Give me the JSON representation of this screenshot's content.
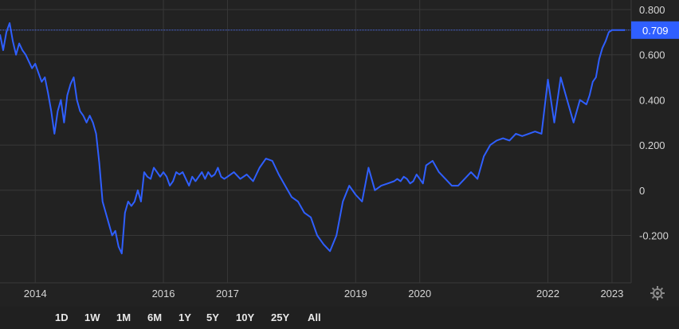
{
  "chart_data": {
    "type": "line",
    "ylim": [
      -0.3,
      0.8
    ],
    "y_ticks": [
      "0.800",
      "0.600",
      "0.400",
      "0.200",
      "0",
      "-0.200"
    ],
    "y_tick_values": [
      0.8,
      0.6,
      0.4,
      0.2,
      0,
      -0.2
    ],
    "x_ticks": [
      "2014",
      "2016",
      "2017",
      "2019",
      "2020",
      "2022",
      "2023"
    ],
    "x_tick_values": [
      2014.0,
      2016.0,
      2017.0,
      2019.0,
      2020.0,
      2022.0,
      2023.0
    ],
    "xlim": [
      2013.45,
      2023.2
    ],
    "grid": true,
    "last_value_label": "0.709",
    "last_value": 0.709,
    "line_color": "#2f5fff",
    "series": [
      {
        "x": [
          2013.45,
          2013.5,
          2013.55,
          2013.6,
          2013.65,
          2013.7,
          2013.75,
          2013.8,
          2013.85,
          2013.9,
          2013.95,
          2014.0,
          2014.05,
          2014.1,
          2014.15,
          2014.2,
          2014.25,
          2014.3,
          2014.35,
          2014.4,
          2014.45,
          2014.5,
          2014.55,
          2014.6,
          2014.65,
          2014.7,
          2014.75,
          2014.8,
          2014.85,
          2014.9,
          2014.95,
          2015.0,
          2015.05,
          2015.1,
          2015.15,
          2015.2,
          2015.25,
          2015.3,
          2015.35,
          2015.4,
          2015.45,
          2015.5,
          2015.55,
          2015.6,
          2015.65,
          2015.7,
          2015.75,
          2015.8,
          2015.85,
          2015.9,
          2015.95,
          2016.0,
          2016.05,
          2016.1,
          2016.15,
          2016.2,
          2016.25,
          2016.3,
          2016.35,
          2016.4,
          2016.45,
          2016.5,
          2016.55,
          2016.6,
          2016.65,
          2016.7,
          2016.75,
          2016.8,
          2016.85,
          2016.9,
          2016.95,
          2017.0,
          2017.1,
          2017.2,
          2017.3,
          2017.4,
          2017.5,
          2017.6,
          2017.7,
          2017.8,
          2017.9,
          2018.0,
          2018.1,
          2018.2,
          2018.3,
          2018.4,
          2018.5,
          2018.6,
          2018.7,
          2018.8,
          2018.9,
          2019.0,
          2019.1,
          2019.2,
          2019.3,
          2019.4,
          2019.5,
          2019.6,
          2019.65,
          2019.7,
          2019.75,
          2019.8,
          2019.85,
          2019.9,
          2019.95,
          2020.0,
          2020.05,
          2020.1,
          2020.2,
          2020.3,
          2020.4,
          2020.5,
          2020.6,
          2020.7,
          2020.8,
          2020.9,
          2021.0,
          2021.1,
          2021.2,
          2021.3,
          2021.4,
          2021.5,
          2021.6,
          2021.7,
          2021.8,
          2021.9,
          2022.0,
          2022.1,
          2022.2,
          2022.3,
          2022.4,
          2022.5,
          2022.6,
          2022.65,
          2022.7,
          2022.75,
          2022.8,
          2022.85,
          2022.9,
          2022.95,
          2023.0,
          2023.05,
          2023.1,
          2023.15,
          2023.2
        ],
        "y": [
          0.69,
          0.62,
          0.7,
          0.74,
          0.66,
          0.6,
          0.65,
          0.62,
          0.6,
          0.57,
          0.54,
          0.56,
          0.52,
          0.48,
          0.5,
          0.43,
          0.35,
          0.25,
          0.35,
          0.4,
          0.3,
          0.42,
          0.47,
          0.5,
          0.4,
          0.35,
          0.33,
          0.3,
          0.33,
          0.3,
          0.25,
          0.12,
          -0.05,
          -0.1,
          -0.15,
          -0.2,
          -0.18,
          -0.25,
          -0.28,
          -0.1,
          -0.05,
          -0.07,
          -0.05,
          0.0,
          -0.05,
          0.08,
          0.06,
          0.05,
          0.1,
          0.08,
          0.06,
          0.08,
          0.06,
          0.02,
          0.04,
          0.08,
          0.07,
          0.08,
          0.05,
          0.02,
          0.06,
          0.04,
          0.06,
          0.08,
          0.05,
          0.08,
          0.06,
          0.07,
          0.1,
          0.06,
          0.05,
          0.06,
          0.08,
          0.05,
          0.07,
          0.04,
          0.1,
          0.14,
          0.13,
          0.07,
          0.02,
          -0.03,
          -0.05,
          -0.1,
          -0.12,
          -0.2,
          -0.24,
          -0.27,
          -0.2,
          -0.05,
          0.02,
          -0.02,
          -0.05,
          0.1,
          0.0,
          0.02,
          0.03,
          0.04,
          0.05,
          0.04,
          0.06,
          0.05,
          0.03,
          0.04,
          0.07,
          0.05,
          0.03,
          0.11,
          0.13,
          0.08,
          0.05,
          0.02,
          0.02,
          0.05,
          0.08,
          0.05,
          0.15,
          0.2,
          0.22,
          0.23,
          0.22,
          0.25,
          0.24,
          0.25,
          0.26,
          0.25,
          0.49,
          0.3,
          0.5,
          0.4,
          0.3,
          0.4,
          0.38,
          0.42,
          0.48,
          0.5,
          0.58,
          0.63,
          0.66,
          0.7,
          0.709,
          0.709,
          0.709,
          0.709,
          0.709
        ]
      }
    ]
  },
  "range_buttons": [
    "1D",
    "1W",
    "1M",
    "6M",
    "1Y",
    "5Y",
    "10Y",
    "25Y",
    "All"
  ],
  "icons": {
    "settings": "gear-icon"
  }
}
